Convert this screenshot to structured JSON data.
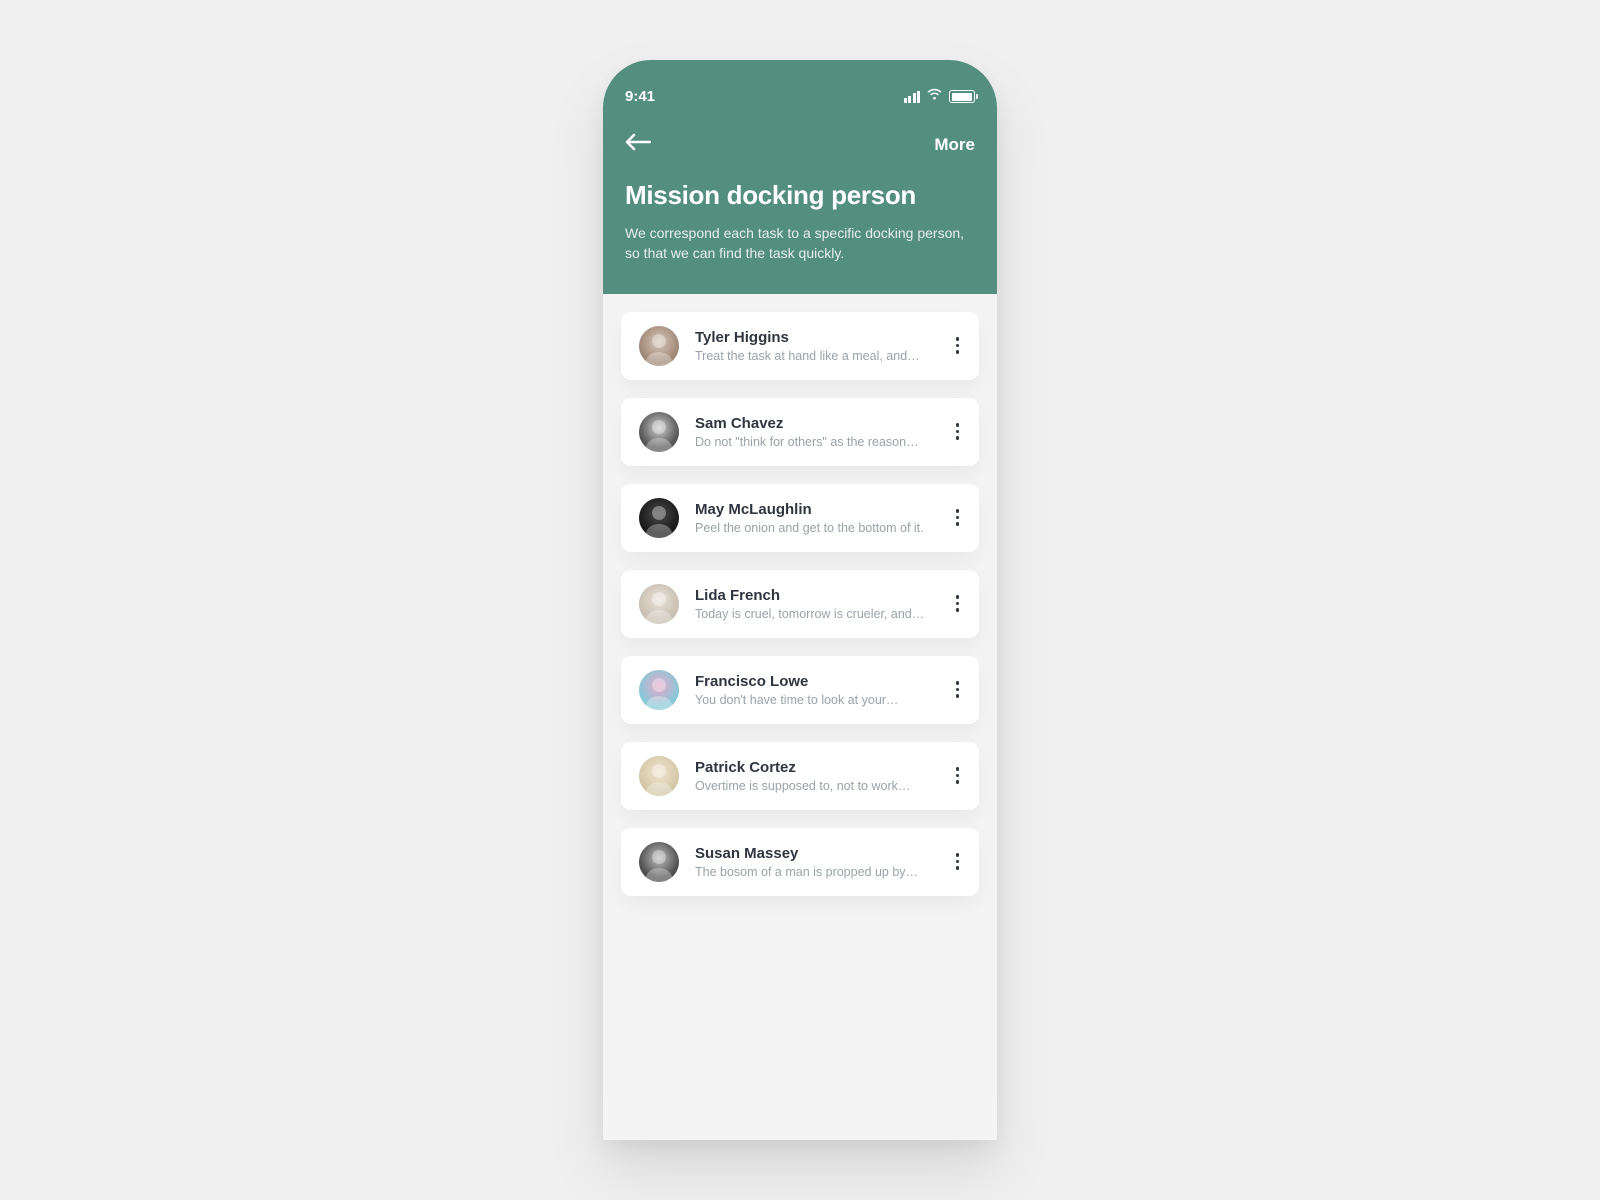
{
  "statusBar": {
    "time": "9:41"
  },
  "nav": {
    "more_label": "More"
  },
  "header": {
    "title": "Mission docking person",
    "subtitle": "We correspond each task to a specific docking person, so that we can find the task quickly."
  },
  "people": [
    {
      "name": "Tyler Higgins",
      "desc": "Treat the task at hand like a meal, and…"
    },
    {
      "name": "Sam Chavez",
      "desc": "Do not \"think for others\" as the reason…"
    },
    {
      "name": "May McLaughlin",
      "desc": "Peel the onion and get to the bottom of it."
    },
    {
      "name": "Lida French",
      "desc": "Today is cruel, tomorrow is crueler, and…"
    },
    {
      "name": "Francisco Lowe",
      "desc": "You don't have time to look at your…"
    },
    {
      "name": "Patrick Cortez",
      "desc": "Overtime is supposed to, not to work…"
    },
    {
      "name": "Susan Massey",
      "desc": "The bosom of a man is propped up by…"
    }
  ],
  "avatarColors": [
    [
      "#d8c8b8",
      "#a08878"
    ],
    [
      "#cfcfcf",
      "#555555"
    ],
    [
      "#4a4a4a",
      "#1a1a1a"
    ],
    [
      "#eae4db",
      "#c9bfb2"
    ],
    [
      "#e8a8c8",
      "#88c8d8"
    ],
    [
      "#f0e4d0",
      "#d4c8a8"
    ],
    [
      "#bfbfbf",
      "#4f4f4f"
    ]
  ]
}
